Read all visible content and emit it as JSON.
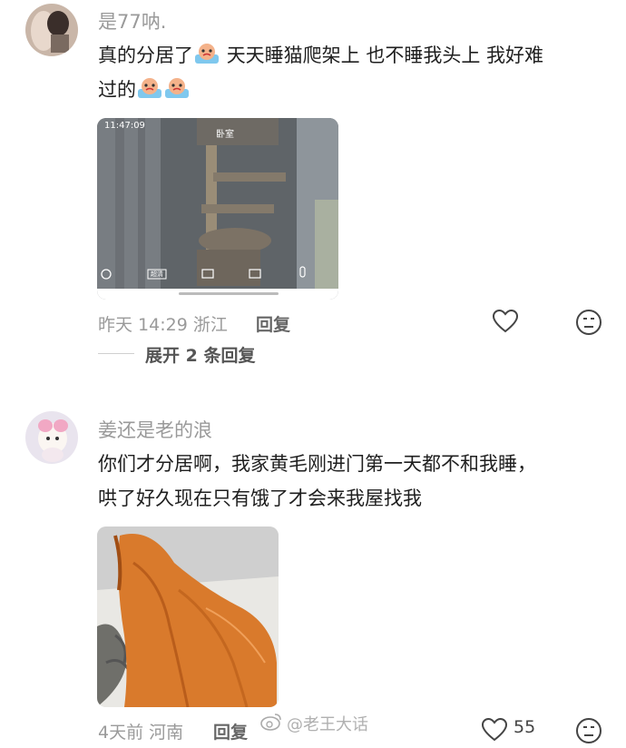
{
  "comments": [
    {
      "username": "是77呐.",
      "text_line1": "真的分居了",
      "text_line1b": "天天睡猫爬架上 也不睡我头上 我好难",
      "text_line2": "过的",
      "image": {
        "timestamp": "11:47:09",
        "room_label": "卧室",
        "hd_label": "超清"
      },
      "time": "昨天 14:29",
      "location": "浙江",
      "reply_label": "回复",
      "expand_label": "展开 2 条回复"
    },
    {
      "username": "姜还是老的浪",
      "text_line1": "你们才分居啊，我家黄毛刚进门第一天都不和我睡，",
      "text_line2": "哄了好久现在只有饿了才会来我屋找我",
      "time": "4天前",
      "location": "河南",
      "reply_label": "回复",
      "like_count": "55"
    }
  ],
  "watermark": "@老王大话",
  "icons": [
    "heart-icon",
    "dislike-face-icon",
    "crying-emoji-icon",
    "weibo-logo-icon"
  ]
}
